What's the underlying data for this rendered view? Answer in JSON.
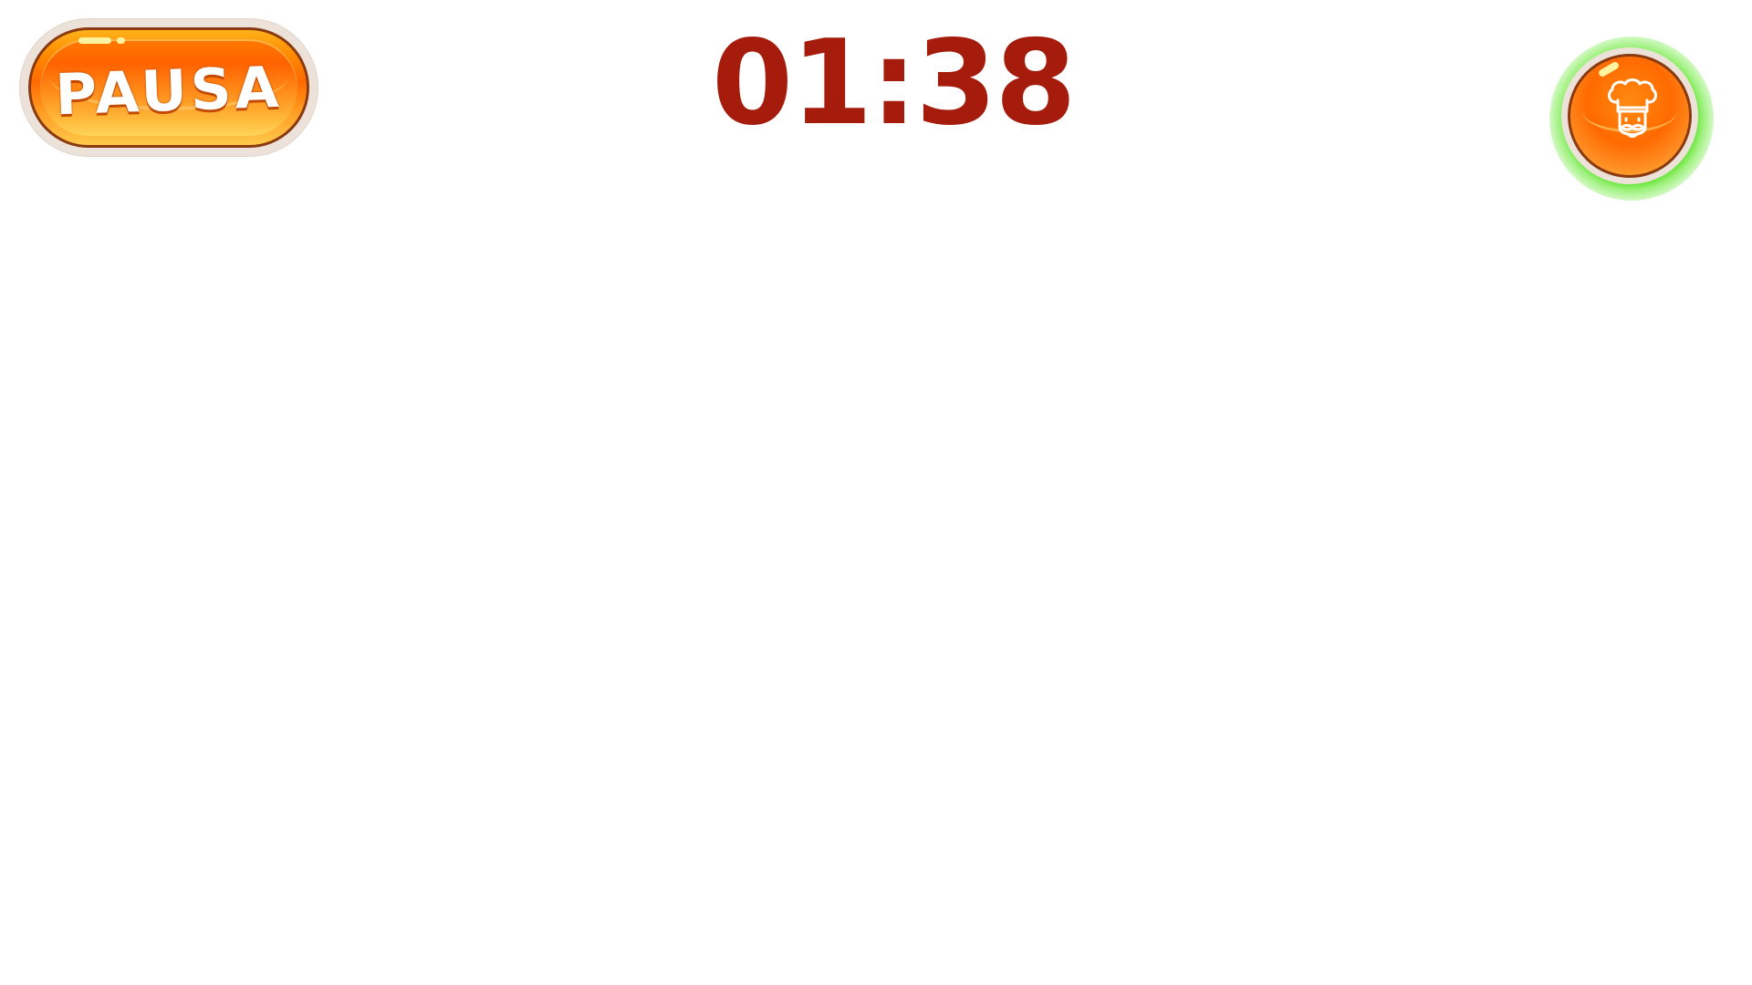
{
  "hud": {
    "pause_label": "PAUSA",
    "timer": "01:38",
    "timer_color": "#a51c0c",
    "button_color": "#ff6a00",
    "highlight_glow_color": "#3cdc00"
  },
  "icons": {
    "chef_button_icon": "chef-hat-mustache-icon"
  }
}
